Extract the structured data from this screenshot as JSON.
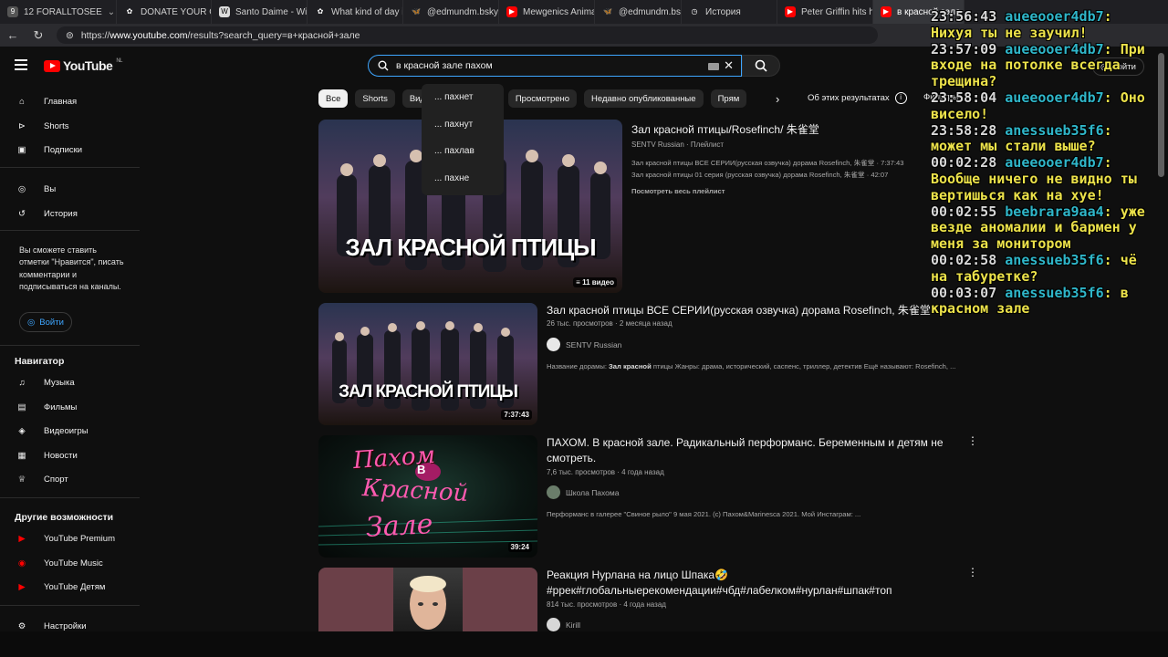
{
  "browser": {
    "tabs": [
      {
        "label": "12 FORALLTOSEE",
        "icon": "counter-badge-icon",
        "color": "#7a7a7a",
        "badge": "9"
      },
      {
        "label": "DONATE YOUR GA",
        "icon": "donate-icon",
        "color": "#e86a3a"
      },
      {
        "label": "Santo Daime - Wik",
        "icon": "wikipedia-icon",
        "color": "#ffffff"
      },
      {
        "label": "What kind of day is",
        "icon": "site-icon",
        "color": "#e86a3a"
      },
      {
        "label": "@edmundm.bsky",
        "icon": "bluesky-icon",
        "color": "#3c8cff"
      },
      {
        "label": "Mewgenics Animat",
        "icon": "youtube-icon",
        "color": "#ff0000"
      },
      {
        "label": "@edmundm.bsky",
        "icon": "bluesky-icon",
        "color": "#3c8cff"
      },
      {
        "label": "История",
        "icon": "history-icon",
        "color": "#ffffff"
      },
      {
        "label": "Peter Griffin hits h",
        "icon": "youtube-icon",
        "color": "#ff0000"
      },
      {
        "label": "в красной зале",
        "icon": "youtube-icon",
        "color": "#ff0000",
        "active": true
      }
    ],
    "url_prefix": "https://",
    "url_host": "www.youtube.com",
    "url_path": "/results?search_query=в+красной+зале"
  },
  "header": {
    "logo_text": "YouTube",
    "logo_region": "NL",
    "search_value": "в красной зале пахом",
    "signin_label": "Войти"
  },
  "suggestions": [
    "... пахнет",
    "... пахнут",
    "... пахлав",
    "... пахне"
  ],
  "sidebar": {
    "items_top": [
      {
        "label": "Главная",
        "icon": "home-icon"
      },
      {
        "label": "Shorts",
        "icon": "shorts-icon"
      },
      {
        "label": "Подписки",
        "icon": "subscriptions-icon"
      }
    ],
    "items_you": [
      {
        "label": "Вы",
        "icon": "user-circle-icon"
      },
      {
        "label": "История",
        "icon": "history-icon"
      }
    ],
    "note": "Вы сможете ставить отметки \"Нравится\", писать комментарии и подписываться на каналы.",
    "login_label": "Войти",
    "navigator_title": "Навигатор",
    "navigator": [
      {
        "label": "Музыка",
        "icon": "music-icon"
      },
      {
        "label": "Фильмы",
        "icon": "film-icon"
      },
      {
        "label": "Видеоигры",
        "icon": "gamepad-icon"
      },
      {
        "label": "Новости",
        "icon": "news-icon"
      },
      {
        "label": "Спорт",
        "icon": "trophy-icon"
      }
    ],
    "other_title": "Другие возможности",
    "other": [
      {
        "label": "YouTube Premium",
        "icon": "youtube-premium-icon"
      },
      {
        "label": "YouTube Music",
        "icon": "youtube-music-icon"
      },
      {
        "label": "YouTube Детям",
        "icon": "youtube-kids-icon"
      }
    ],
    "settings_label": "Настройки"
  },
  "chips": [
    "Все",
    "Shorts",
    "Видео",
    "Непросмотренные",
    "Просмотрено",
    "Недавно опубликованные",
    "Прямые трансляции"
  ],
  "chips_visible": [
    "Все",
    "Shorts",
    "Виде",
    "нные",
    "Просмотрено",
    "Недавно опубликованные",
    "Прям"
  ],
  "about_label": "Об этих результатах",
  "filters_label": "Фильтры",
  "results": [
    {
      "title": "Зал красной птицы/Rosefinch/ 朱雀堂",
      "channel": "SENTV Russian",
      "kind": "Плейлист",
      "overlay_text": "ЗАЛ КРАСНОЙ ПТИЦЫ",
      "count_label": "11 видео",
      "list": [
        "Зал красной птицы ВСЕ СЕРИИ(русская озвучка) дорама Rosefinch, 朱雀堂 · 7:37:43",
        "Зал красной птицы 01 серия (русская озвучка) дорама Rosefinch, 朱雀堂 · 42:07"
      ],
      "view_all": "Посмотреть весь плейлист"
    },
    {
      "title": "Зал красной птицы ВСЕ СЕРИИ(русская озвучка) дорама Rosefinch, 朱雀堂",
      "views": "26 тыс. просмотров",
      "age": "2 месяца назад",
      "channel": "SENTV Russian",
      "overlay_text": "ЗАЛ КРАСНОЙ ПТИЦЫ",
      "duration": "7:37:43",
      "desc_pre": "Название дорамы: ",
      "desc_bold": "Зал красной",
      "desc_post": " птицы Жанры: драма, исторический, саспенс, триллер, детектив Ещё называют: Rosefinch, ..."
    },
    {
      "title": "ПАХОМ. В красной зале. Радикальный перформанс. Беременным и детям не смотреть.",
      "views": "7,6 тыс. просмотров",
      "age": "4 года назад",
      "channel": "Школа Пахома",
      "duration": "39:24",
      "desc": "Перформанс в галерее \"Свиное рыло\" 9 мая 2021. (с) Пахом&Marinesca 2021. Мой Инстаграм: ..."
    },
    {
      "title": "Реакция Нурлана на лицо Шпака🤣 #ррек#глобальныерекомендации#чбд#лабелком#нурлан#шпак#топ",
      "views": "814 тыс. просмотров",
      "age": "4 года назад",
      "channel": "Kirill"
    }
  ],
  "chat": [
    {
      "time": "23:56:43",
      "user": "aueeooer4db7",
      "text": "Нихуя ты не заучил!"
    },
    {
      "time": "23:57:09",
      "user": "aueeooer4db7",
      "text": "При входе на потолке всегда трещина?"
    },
    {
      "time": "23:58:04",
      "user": "aueeooer4db7",
      "text": "Оно висело!"
    },
    {
      "time": "23:58:28",
      "user": "anessueb35f6",
      "text": "может мы стали выше?"
    },
    {
      "time": "00:02:28",
      "user": "aueeooer4db7",
      "text": "Вообще ничего не видно ты вертишься как на хуе!"
    },
    {
      "time": "00:02:55",
      "user": "beebrara9aa4",
      "text": "уже везде аномалии и бармен у меня за монитором"
    },
    {
      "time": "00:02:58",
      "user": "anessueb35f6",
      "text": "чё на табуретке?"
    },
    {
      "time": "00:03:07",
      "user": "anessueb35f6",
      "text": "в красном зале"
    }
  ],
  "colors": {
    "accent": "#3ea6ff",
    "brand": "#ff0000",
    "chat_text": "#ece24a",
    "chat_user": "#2fb6c9"
  }
}
